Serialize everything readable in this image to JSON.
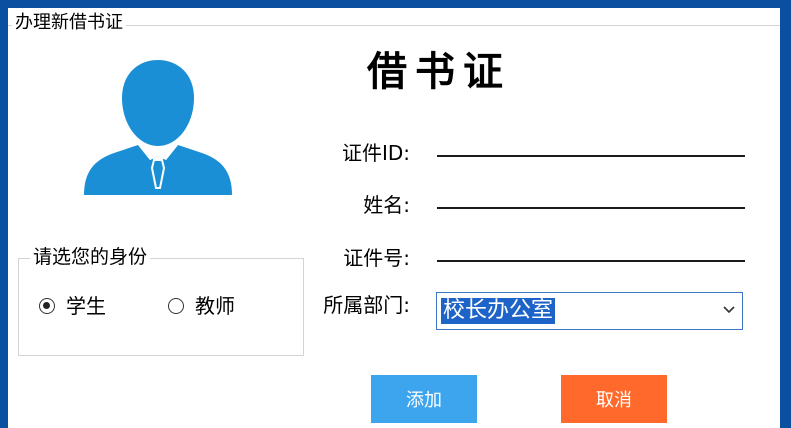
{
  "window": {
    "group_title": "办理新借书证"
  },
  "card": {
    "heading": "借书证"
  },
  "form": {
    "id_label": "证件ID:",
    "name_label": "姓名:",
    "card_no_label": "证件号:",
    "dept_label": "所属部门:",
    "dept_value": "校长办公室"
  },
  "role": {
    "title": "请选您的身份",
    "options": [
      {
        "label": "学生",
        "checked": true
      },
      {
        "label": "教师",
        "checked": false
      }
    ]
  },
  "buttons": {
    "add_label": "添加",
    "cancel_label": "取消"
  },
  "icons": {
    "avatar": "user-avatar-icon",
    "dropdown": "chevron-down-icon"
  },
  "colors": {
    "frame": "#0b4fa0",
    "avatar": "#1a8fd6",
    "add_button": "#3da5ee",
    "cancel_button": "#ff6a2c",
    "selection": "#1e63c8"
  }
}
